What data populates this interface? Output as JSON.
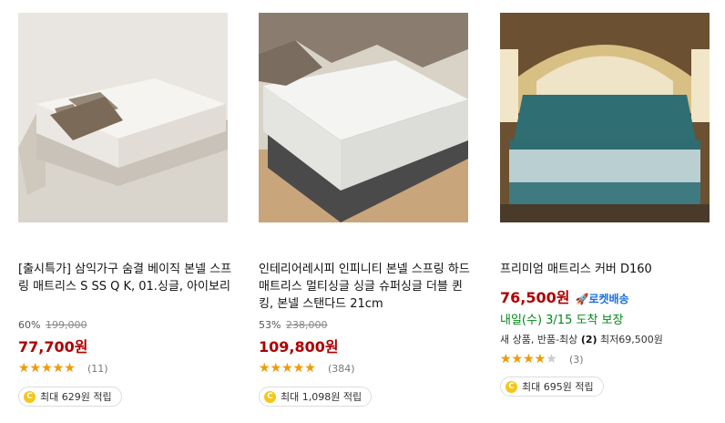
{
  "products": [
    {
      "title": "[출시특가] 삼익가구 숨결 베이직 본넬 스프링 매트리스 S SS Q K, 01.싱글, 아이보리",
      "discount": "60%",
      "original_price": "199,000",
      "price": "77,700원",
      "rating": 4.5,
      "review_count": "(11)",
      "reward": "최대 629원 적립",
      "image": "ivory-mattress-on-bed-frame"
    },
    {
      "title": "인테리어레시피 인피니티 본넬 스프링 하드 매트리스 멀티싱글 싱글 슈퍼싱글 더블 퀸 킹, 본넬 스탠다드 21cm",
      "discount": "53%",
      "original_price": "238,000",
      "price": "109,800원",
      "rating": 4.5,
      "review_count": "(384)",
      "reward": "최대 1,098원 적립",
      "image": "mattress-with-blanket"
    },
    {
      "title": "프리미엄 매트리스 커버 D160",
      "price": "76,500원",
      "rocket_label": "로켓배송",
      "delivery": "내일(수) 3/15 도착 보장",
      "seller_prefix": "새 상품, 반품-최상",
      "seller_count": "(2)",
      "seller_min_price": "최저69,500원",
      "rating": 3.5,
      "review_count": "(3)",
      "reward": "최대 695원 적립",
      "image": "teal-lace-bed-cover"
    }
  ],
  "icons": {
    "star": "★",
    "coin": "C",
    "rocket": "🚀"
  },
  "colors": {
    "price": "#ae0000",
    "star": "#f39a00",
    "delivery": "#00891a",
    "rocket": "#1a6fd6"
  }
}
